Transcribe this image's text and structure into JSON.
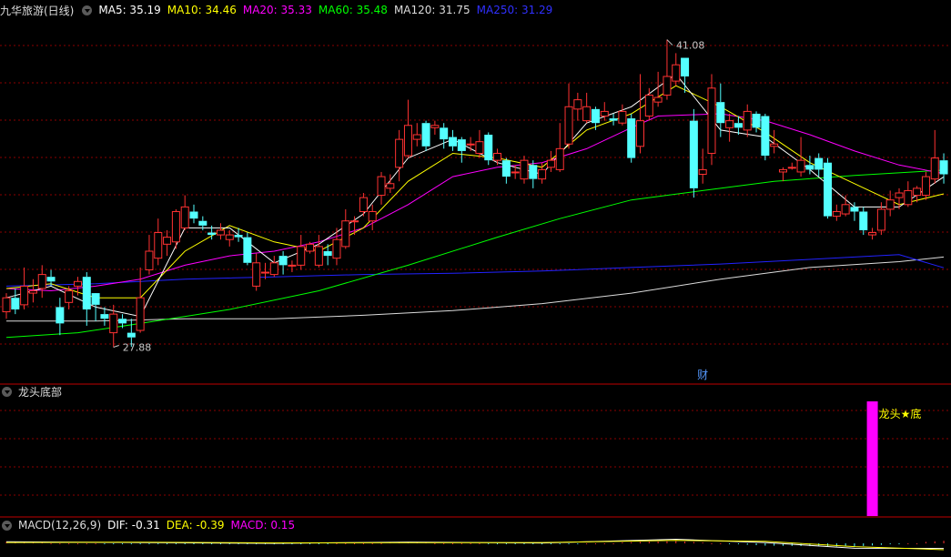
{
  "main_header": {
    "title": "九华旅游(日线)",
    "ma": [
      {
        "label": "MA5: 35.19",
        "color": "#ffffff"
      },
      {
        "label": "MA10: 34.46",
        "color": "#ffff00"
      },
      {
        "label": "MA20: 35.33",
        "color": "#ff00ff"
      },
      {
        "label": "MA60: 35.48",
        "color": "#00ff00"
      },
      {
        "label": "MA120: 31.75",
        "color": "#dcdcdc"
      },
      {
        "label": "MA250: 31.29",
        "color": "#2222ff"
      }
    ]
  },
  "indicator_header": {
    "title": "龙头底部"
  },
  "macd_header": {
    "title": "MACD(12,26,9)",
    "dif": "DIF: -0.31",
    "dea": "DEA: -0.39",
    "macd": "MACD: 0.15",
    "dif_color": "#ffffff",
    "dea_color": "#ffff00",
    "macd_color": "#ff00ff"
  },
  "annotations": {
    "high_label": "41.08",
    "low_label": "27.88",
    "finance_marker": "财",
    "signal_label": "龙头★底"
  },
  "colors": {
    "up": "#ff3232",
    "down": "#54ffff",
    "grid": "#8b0000",
    "signal": "#ff00ff"
  },
  "chart_data": {
    "type": "candlestick",
    "y_range": [
      27.0,
      42.0
    ],
    "high": 41.08,
    "low": 27.88,
    "candles": [
      [
        29.4,
        30.0,
        30.2,
        29.1
      ],
      [
        30.0,
        29.5,
        30.4,
        29.3
      ],
      [
        29.7,
        30.5,
        31.3,
        29.5
      ],
      [
        30.2,
        30.3,
        30.8,
        29.8
      ],
      [
        30.4,
        31.0,
        31.4,
        30.0
      ],
      [
        30.9,
        30.7,
        31.2,
        30.5
      ],
      [
        29.6,
        28.9,
        30.0,
        28.4
      ],
      [
        29.8,
        30.3,
        30.5,
        29.5
      ],
      [
        30.5,
        30.7,
        30.9,
        30.1
      ],
      [
        30.9,
        29.5,
        31.1,
        28.8
      ],
      [
        30.2,
        29.7,
        30.1,
        29.0
      ],
      [
        29.3,
        29.1,
        29.6,
        28.8
      ],
      [
        28.5,
        29.3,
        29.7,
        27.88
      ],
      [
        29.1,
        28.9,
        29.3,
        28.7
      ],
      [
        28.5,
        28.3,
        29.1,
        27.9
      ],
      [
        28.6,
        30.0,
        31.3,
        28.5
      ],
      [
        31.2,
        32.0,
        32.7,
        31.0
      ],
      [
        31.7,
        32.8,
        33.4,
        31.4
      ],
      [
        32.3,
        32.6,
        32.9,
        31.8
      ],
      [
        32.4,
        33.7,
        33.8,
        32.1
      ],
      [
        33.0,
        33.9,
        34.4,
        32.9
      ],
      [
        33.7,
        33.4,
        34.0,
        33.2
      ],
      [
        33.3,
        33.1,
        33.5,
        32.9
      ],
      [
        32.8,
        32.7,
        33.1,
        32.5
      ],
      [
        32.7,
        32.9,
        33.2,
        32.5
      ],
      [
        32.5,
        32.7,
        32.9,
        32.2
      ],
      [
        32.7,
        32.6,
        33.0,
        32.4
      ],
      [
        32.6,
        31.5,
        32.8,
        31.4
      ],
      [
        30.5,
        31.5,
        31.9,
        30.3
      ],
      [
        31.1,
        31.1,
        31.5,
        30.8
      ],
      [
        31.0,
        31.5,
        31.8,
        30.9
      ],
      [
        31.8,
        31.4,
        32.0,
        31.0
      ],
      [
        31.4,
        31.4,
        31.6,
        31.1
      ],
      [
        31.4,
        32.2,
        32.7,
        31.2
      ],
      [
        32.0,
        32.3,
        32.4,
        31.9
      ],
      [
        31.4,
        32.2,
        32.7,
        31.3
      ],
      [
        32.0,
        31.8,
        32.3,
        31.4
      ],
      [
        31.7,
        32.5,
        33.0,
        31.4
      ],
      [
        32.2,
        33.3,
        33.8,
        32.1
      ],
      [
        33.3,
        33.3,
        33.5,
        32.7
      ],
      [
        33.7,
        34.3,
        34.5,
        33.5
      ],
      [
        33.3,
        33.7,
        34.0,
        32.9
      ],
      [
        34.4,
        35.2,
        35.4,
        34.0
      ],
      [
        34.7,
        34.9,
        35.3,
        34.5
      ],
      [
        35.6,
        36.8,
        37.2,
        35.0
      ],
      [
        36.1,
        37.4,
        38.5,
        36.0
      ],
      [
        36.8,
        37.0,
        37.5,
        36.5
      ],
      [
        37.5,
        36.5,
        37.6,
        36.3
      ],
      [
        37.3,
        37.4,
        37.6,
        37.0
      ],
      [
        37.3,
        36.8,
        37.5,
        36.4
      ],
      [
        36.9,
        36.5,
        37.2,
        36.3
      ],
      [
        36.8,
        36.3,
        36.9,
        35.8
      ],
      [
        36.6,
        36.6,
        36.9,
        36.3
      ],
      [
        36.2,
        36.7,
        37.2,
        36.0
      ],
      [
        37.0,
        35.9,
        37.1,
        35.7
      ],
      [
        35.9,
        36.2,
        36.4,
        35.7
      ],
      [
        35.9,
        35.2,
        36.0,
        34.9
      ],
      [
        35.4,
        35.4,
        35.7,
        35.1
      ],
      [
        35.1,
        35.9,
        36.1,
        34.9
      ],
      [
        35.7,
        35.1,
        35.9,
        34.7
      ],
      [
        35.1,
        35.5,
        35.8,
        34.9
      ],
      [
        35.6,
        35.9,
        36.3,
        35.4
      ],
      [
        35.5,
        36.4,
        37.5,
        35.4
      ],
      [
        36.6,
        38.2,
        39.2,
        36.4
      ],
      [
        38.1,
        38.5,
        38.8,
        37.6
      ],
      [
        37.6,
        38.2,
        38.8,
        37.5
      ],
      [
        38.1,
        37.5,
        38.2,
        37.2
      ],
      [
        37.8,
        38.0,
        38.4,
        37.6
      ],
      [
        37.7,
        37.6,
        37.9,
        37.4
      ],
      [
        37.5,
        38.0,
        38.3,
        37.4
      ],
      [
        37.7,
        36.0,
        37.9,
        35.8
      ],
      [
        36.5,
        37.6,
        39.6,
        36.2
      ],
      [
        37.8,
        38.7,
        39.0,
        37.6
      ],
      [
        38.4,
        38.6,
        39.7,
        38.2
      ],
      [
        38.7,
        39.5,
        41.08,
        38.5
      ],
      [
        39.3,
        40.0,
        40.5,
        39.1
      ],
      [
        40.3,
        39.5,
        40.3,
        38.8
      ],
      [
        37.6,
        34.7,
        38.1,
        34.3
      ],
      [
        35.3,
        35.5,
        36.4,
        34.9
      ],
      [
        36.2,
        39.0,
        39.6,
        35.7
      ],
      [
        38.4,
        37.5,
        39.2,
        36.9
      ],
      [
        37.3,
        37.6,
        37.9,
        36.7
      ],
      [
        37.5,
        37.3,
        37.8,
        37.0
      ],
      [
        37.2,
        38.0,
        38.3,
        36.9
      ],
      [
        37.9,
        37.3,
        38.0,
        37.1
      ],
      [
        37.8,
        36.1,
        37.9,
        35.9
      ],
      [
        36.5,
        36.6,
        37.2,
        36.2
      ],
      [
        35.4,
        35.5,
        35.6,
        35.0
      ],
      [
        35.6,
        35.6,
        35.8,
        35.5
      ],
      [
        35.4,
        35.9,
        36.9,
        35.2
      ],
      [
        35.7,
        35.5,
        36.1,
        35.3
      ],
      [
        36.0,
        35.5,
        36.2,
        35.2
      ],
      [
        35.8,
        33.5,
        36.0,
        33.4
      ],
      [
        33.5,
        33.7,
        34.0,
        33.3
      ],
      [
        33.6,
        34.0,
        34.4,
        33.5
      ],
      [
        33.9,
        33.7,
        34.1,
        33.3
      ],
      [
        33.7,
        32.9,
        33.9,
        32.7
      ],
      [
        32.7,
        32.8,
        33.0,
        32.5
      ],
      [
        32.9,
        33.8,
        34.1,
        32.7
      ],
      [
        33.8,
        34.2,
        34.6,
        33.5
      ],
      [
        34.3,
        34.5,
        34.7,
        33.8
      ],
      [
        34.0,
        34.6,
        35.0,
        33.9
      ],
      [
        34.4,
        34.7,
        34.8,
        34.1
      ],
      [
        34.4,
        35.2,
        35.4,
        34.2
      ],
      [
        35.1,
        36.0,
        37.2,
        34.9
      ],
      [
        35.9,
        35.3,
        36.2,
        34.9
      ]
    ],
    "ma120": [
      [
        0,
        29.0
      ],
      [
        10,
        29.0
      ],
      [
        20,
        29.1
      ],
      [
        30,
        29.1
      ],
      [
        40,
        29.25
      ],
      [
        50,
        29.45
      ],
      [
        60,
        29.75
      ],
      [
        70,
        30.2
      ],
      [
        80,
        30.8
      ],
      [
        90,
        31.3
      ],
      [
        100,
        31.55
      ],
      [
        105,
        31.75
      ]
    ],
    "ma250": [
      [
        0,
        30.5
      ],
      [
        10,
        30.6
      ],
      [
        20,
        30.8
      ],
      [
        30,
        30.9
      ],
      [
        40,
        31.0
      ],
      [
        50,
        31.05
      ],
      [
        60,
        31.15
      ],
      [
        70,
        31.3
      ],
      [
        80,
        31.45
      ],
      [
        90,
        31.65
      ],
      [
        100,
        31.85
      ],
      [
        105,
        31.29
      ]
    ],
    "ma60": [
      [
        0,
        28.3
      ],
      [
        8,
        28.5
      ],
      [
        15,
        28.9
      ],
      [
        25,
        29.5
      ],
      [
        35,
        30.3
      ],
      [
        45,
        31.4
      ],
      [
        55,
        32.6
      ],
      [
        62,
        33.4
      ],
      [
        70,
        34.2
      ],
      [
        78,
        34.6
      ],
      [
        86,
        35.0
      ],
      [
        95,
        35.25
      ],
      [
        105,
        35.48
      ]
    ],
    "ma20": [
      [
        0,
        30.4
      ],
      [
        5,
        30.3
      ],
      [
        10,
        30.5
      ],
      [
        15,
        30.8
      ],
      [
        20,
        31.4
      ],
      [
        25,
        31.8
      ],
      [
        30,
        32.0
      ],
      [
        35,
        32.4
      ],
      [
        40,
        33.0
      ],
      [
        45,
        34.0
      ],
      [
        50,
        35.2
      ],
      [
        55,
        35.6
      ],
      [
        60,
        35.8
      ],
      [
        65,
        36.4
      ],
      [
        70,
        37.3
      ],
      [
        73,
        37.8
      ],
      [
        80,
        37.9
      ],
      [
        85,
        37.6
      ],
      [
        90,
        37.0
      ],
      [
        95,
        36.3
      ],
      [
        100,
        35.7
      ],
      [
        105,
        35.33
      ]
    ],
    "ma10": [
      [
        0,
        30.4
      ],
      [
        5,
        30.6
      ],
      [
        10,
        30.0
      ],
      [
        15,
        30.0
      ],
      [
        20,
        32.0
      ],
      [
        25,
        33.1
      ],
      [
        30,
        32.4
      ],
      [
        35,
        32.0
      ],
      [
        40,
        33.0
      ],
      [
        45,
        35.0
      ],
      [
        50,
        36.2
      ],
      [
        55,
        36.0
      ],
      [
        60,
        35.6
      ],
      [
        65,
        37.2
      ],
      [
        70,
        37.9
      ],
      [
        75,
        39.1
      ],
      [
        80,
        38.2
      ],
      [
        85,
        37.1
      ],
      [
        90,
        35.8
      ],
      [
        95,
        34.9
      ],
      [
        100,
        34.0
      ],
      [
        105,
        34.46
      ]
    ],
    "ma5": [
      [
        0,
        30.0
      ],
      [
        5,
        30.5
      ],
      [
        10,
        29.6
      ],
      [
        15,
        29.2
      ],
      [
        20,
        33.0
      ],
      [
        25,
        33.0
      ],
      [
        30,
        31.5
      ],
      [
        35,
        32.3
      ],
      [
        40,
        33.6
      ],
      [
        45,
        36.0
      ],
      [
        50,
        36.8
      ],
      [
        55,
        35.8
      ],
      [
        60,
        35.3
      ],
      [
        65,
        37.5
      ],
      [
        70,
        38.2
      ],
      [
        75,
        39.6
      ],
      [
        80,
        37.2
      ],
      [
        85,
        36.9
      ],
      [
        90,
        35.5
      ],
      [
        95,
        33.9
      ],
      [
        100,
        33.9
      ],
      [
        105,
        35.19
      ]
    ],
    "signal": {
      "index": 97,
      "value": 1
    },
    "macd_dif": [
      [
        0,
        0.1
      ],
      [
        15,
        0.05
      ],
      [
        30,
        0.0
      ],
      [
        45,
        0.08
      ],
      [
        60,
        0.02
      ],
      [
        75,
        0.25
      ],
      [
        85,
        0.05
      ],
      [
        95,
        -0.3
      ],
      [
        105,
        -0.31
      ]
    ],
    "macd_dea": [
      [
        0,
        0.05
      ],
      [
        15,
        0.07
      ],
      [
        30,
        0.03
      ],
      [
        45,
        0.04
      ],
      [
        60,
        0.05
      ],
      [
        75,
        0.18
      ],
      [
        85,
        0.12
      ],
      [
        95,
        -0.2
      ],
      [
        105,
        -0.39
      ]
    ]
  }
}
